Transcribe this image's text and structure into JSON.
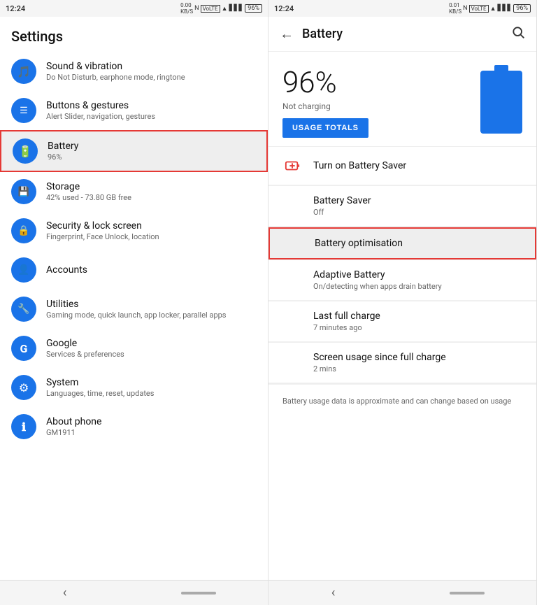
{
  "left_panel": {
    "status_bar": {
      "time": "12:24",
      "data_speed": "0.00\nKB/S",
      "battery": "96%"
    },
    "title": "Settings",
    "items": [
      {
        "id": "sound",
        "icon": "🎵",
        "title": "Sound & vibration",
        "subtitle": "Do Not Disturb, earphone mode, ringtone",
        "active": false
      },
      {
        "id": "buttons",
        "icon": "☰",
        "title": "Buttons & gestures",
        "subtitle": "Alert Slider, navigation, gestures",
        "active": false
      },
      {
        "id": "battery",
        "icon": "🔋",
        "title": "Battery",
        "subtitle": "96%",
        "active": true
      },
      {
        "id": "storage",
        "icon": "💾",
        "title": "Storage",
        "subtitle": "42% used - 73.80 GB free",
        "active": false
      },
      {
        "id": "security",
        "icon": "🔒",
        "title": "Security & lock screen",
        "subtitle": "Fingerprint, Face Unlock, location",
        "active": false
      },
      {
        "id": "accounts",
        "icon": "👤",
        "title": "Accounts",
        "subtitle": "",
        "active": false
      },
      {
        "id": "utilities",
        "icon": "🔧",
        "title": "Utilities",
        "subtitle": "Gaming mode, quick launch, app locker, parallel apps",
        "active": false
      },
      {
        "id": "google",
        "icon": "G",
        "title": "Google",
        "subtitle": "Services & preferences",
        "active": false
      },
      {
        "id": "system",
        "icon": "⚙",
        "title": "System",
        "subtitle": "Languages, time, reset, updates",
        "active": false
      },
      {
        "id": "about",
        "icon": "ℹ",
        "title": "About phone",
        "subtitle": "GM1911",
        "active": false
      }
    ],
    "nav": {
      "back": "‹"
    }
  },
  "right_panel": {
    "status_bar": {
      "time": "12:24",
      "data_speed": "0.01\nKB/S",
      "battery": "96%"
    },
    "header": {
      "title": "Battery",
      "back_icon": "←",
      "search_icon": "🔍"
    },
    "battery_level": "96%",
    "battery_status": "Not charging",
    "usage_totals_btn": "USAGE TOTALS",
    "items": [
      {
        "id": "battery_saver_on",
        "icon": "🔋",
        "icon_color": "red",
        "title": "Turn on Battery Saver",
        "subtitle": "",
        "highlighted": false
      },
      {
        "id": "battery_saver",
        "icon": "",
        "title": "Battery Saver",
        "subtitle": "Off",
        "highlighted": false
      },
      {
        "id": "battery_optimisation",
        "icon": "",
        "title": "Battery optimisation",
        "subtitle": "",
        "highlighted": true
      },
      {
        "id": "adaptive_battery",
        "icon": "",
        "title": "Adaptive Battery",
        "subtitle": "On/detecting when apps drain battery",
        "highlighted": false
      },
      {
        "id": "last_full_charge",
        "icon": "",
        "title": "Last full charge",
        "subtitle": "7 minutes ago",
        "highlighted": false
      },
      {
        "id": "screen_usage",
        "icon": "",
        "title": "Screen usage since full charge",
        "subtitle": "2 mins",
        "highlighted": false
      }
    ],
    "note": "Battery usage data is approximate and can change based on usage",
    "nav": {
      "back": "‹"
    }
  }
}
